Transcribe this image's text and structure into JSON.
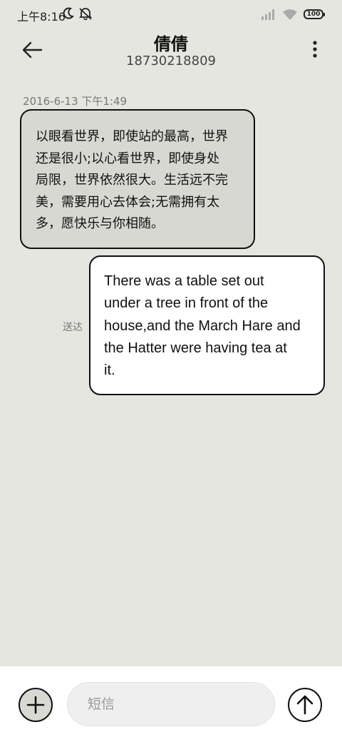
{
  "status_bar": {
    "time": "上午8:16",
    "battery": "100",
    "icons": [
      "moon-icon",
      "mute-icon",
      "signal-icon",
      "wifi-icon",
      "battery-icon"
    ]
  },
  "header": {
    "contact_name": "倩倩",
    "contact_number": "18730218809",
    "icons": [
      "back-arrow-icon",
      "more-vertical-icon"
    ]
  },
  "messages": [
    {
      "direction": "incoming",
      "timestamp": "2016-6-13 下午1:49",
      "lines": [
        "以眼看世界，即使站的最高，世界",
        "还是很小;以心看世界，即使身处",
        "局限，世界依然很大。生活远不完",
        "美，需要用心去体会;无需拥有太",
        "多，愿快乐与你相随。"
      ]
    },
    {
      "direction": "outgoing",
      "status": "送达",
      "lines": [
        "There was a table set out",
        "under a tree in front of the",
        "house,and the March Hare and",
        "the Hatter were having tea at",
        "it."
      ]
    }
  ],
  "compose": {
    "placeholder": "短信",
    "icons": [
      "plus-icon",
      "send-arrow-icon"
    ]
  },
  "colors": {
    "background": "#e6e6e1",
    "incoming_bubble": "#d8d8d3",
    "outgoing_bubble": "#ffffff"
  }
}
